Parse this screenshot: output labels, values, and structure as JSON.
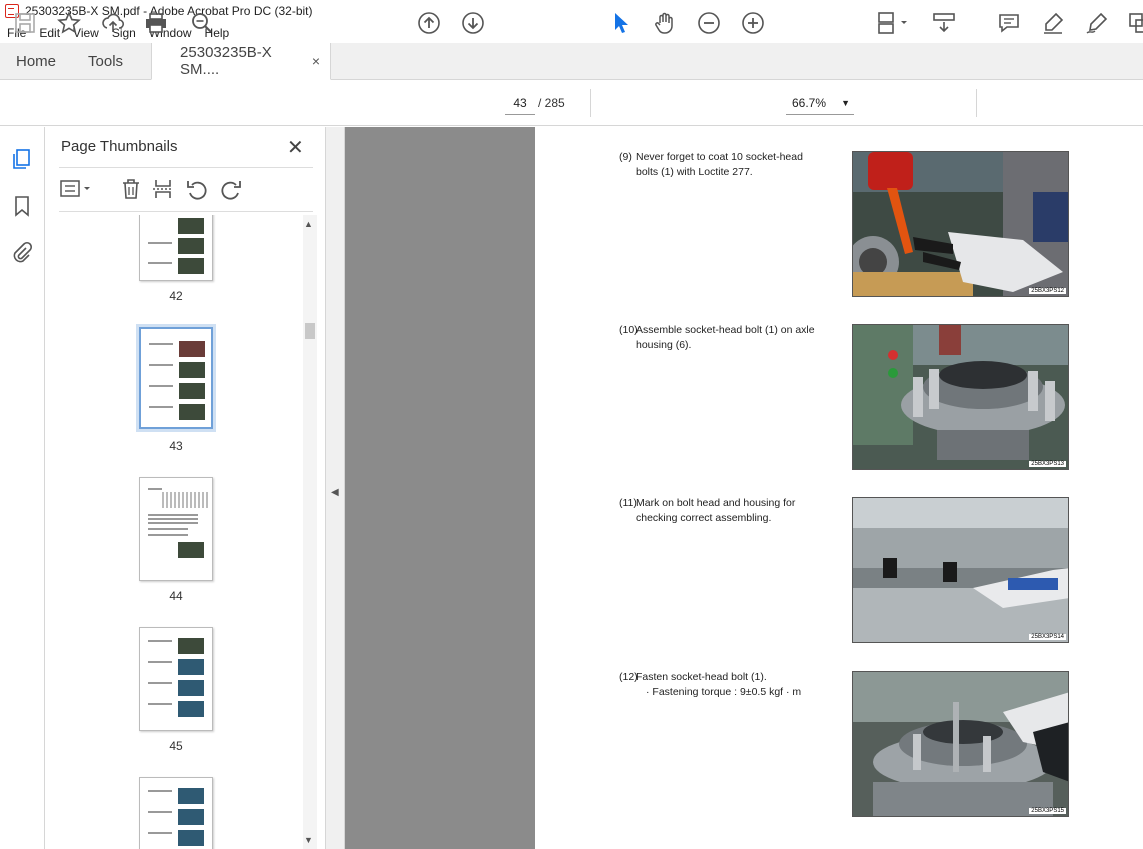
{
  "window": {
    "title": "25303235B-X SM.pdf - Adobe Acrobat Pro DC (32-bit)"
  },
  "menu": [
    "File",
    "Edit",
    "View",
    "Sign",
    "Window",
    "Help"
  ],
  "tabs": {
    "home": "Home",
    "tools": "Tools",
    "document": "25303235B-X SM....",
    "close": "×"
  },
  "toolbar": {
    "page_current": "43",
    "page_total": "/ 285",
    "zoom": "66.7%",
    "icons": [
      "save-icon",
      "bookmark-star-icon",
      "upload-icon",
      "print-icon",
      "search-zoom-icon",
      "page-up-icon",
      "page-down-icon",
      "select-arrow-icon",
      "hand-icon",
      "zoom-out-icon",
      "zoom-in-icon",
      "fit-page-icon",
      "scroll-mode-icon",
      "comment-icon",
      "highlight-icon",
      "sign-icon",
      "more-tools-icon"
    ]
  },
  "panel": {
    "title": "Page Thumbnails",
    "close": "✕",
    "thumbnails": [
      {
        "label": "42"
      },
      {
        "label": "43",
        "active": true
      },
      {
        "label": "44"
      },
      {
        "label": "45"
      },
      {
        "label": ""
      }
    ]
  },
  "document": {
    "steps": [
      {
        "num": "(9)",
        "text": "Never forget to coat 10 socket-head bolts (1) with Loctite 277.",
        "code": "25BX3PS12"
      },
      {
        "num": "(10)",
        "text": "Assemble socket-head bolt (1) on axle housing (6).",
        "code": "25BX3PS13"
      },
      {
        "num": "(11)",
        "text": "Mark on bolt head and housing for checking correct assembling.",
        "code": "25BX3PS14"
      },
      {
        "num": "(12)",
        "text": "Fasten socket-head bolt (1).",
        "sub": "· Fastening torque : 9±0.5 kgf · m",
        "code": "25BX3PS15"
      }
    ]
  },
  "colors": {
    "accent": "#1473e6",
    "acrobat_red": "#d9261c",
    "doc_bg": "#8b8b8b"
  }
}
